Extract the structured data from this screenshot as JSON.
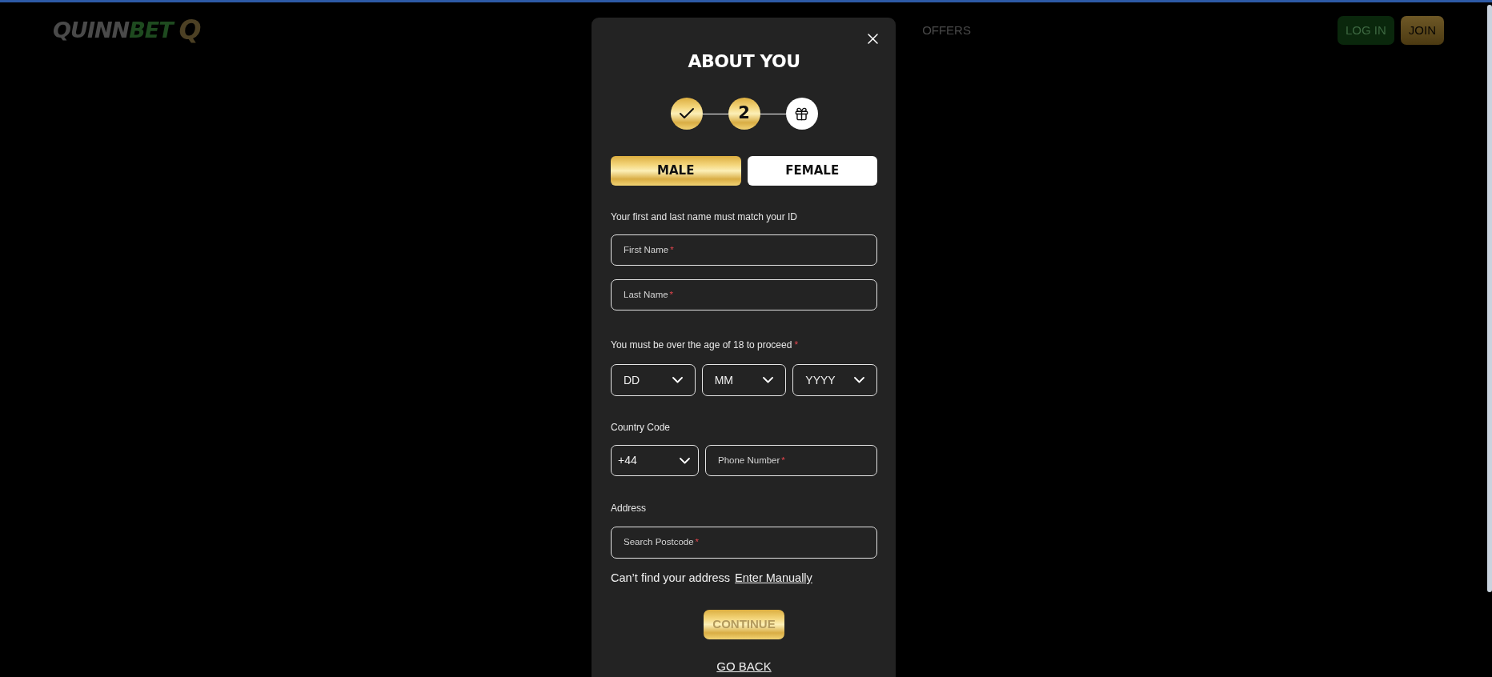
{
  "header": {
    "logo": {
      "wordmark_start": "QUINN",
      "wordmark_end": "BET",
      "emblem": "Q"
    },
    "nav": [
      {
        "label": "OFFERS"
      }
    ],
    "buttons": [
      {
        "kind": "login",
        "label": "LOG IN"
      },
      {
        "kind": "join",
        "label": "JOIN"
      }
    ]
  },
  "modal": {
    "title": "ABOUT YOU",
    "steps": [
      {
        "kind": "done"
      },
      {
        "kind": "current",
        "label": "2"
      },
      {
        "kind": "reward"
      }
    ],
    "gender": [
      {
        "label": "MALE",
        "selected": true
      },
      {
        "label": "FEMALE",
        "selected": false
      }
    ],
    "name_note": "Your first and last name must match your ID",
    "name_fields": [
      {
        "placeholder": "First Name",
        "required_mark": "*"
      },
      {
        "placeholder": "Last Name",
        "required_mark": "*"
      }
    ],
    "age_note": {
      "text": "You must be over the age of 18 to proceed",
      "required_mark": "*"
    },
    "birth_date": [
      {
        "placeholder": "DD"
      },
      {
        "placeholder": "MM"
      },
      {
        "placeholder": "YYYY"
      }
    ],
    "country_code_label": "Country Code",
    "country_code": {
      "value": "+44"
    },
    "phone": {
      "placeholder": "Phone Number",
      "required_mark": "*"
    },
    "address_label": "Address",
    "postcode": {
      "placeholder": "Search Postcode",
      "required_mark": "*"
    },
    "address_hint": "Can’t find your address",
    "manual_link": "Enter Manually",
    "continue_button": {
      "label": "CONTINUE",
      "disabled": true
    },
    "back_link": "GO BACK"
  }
}
